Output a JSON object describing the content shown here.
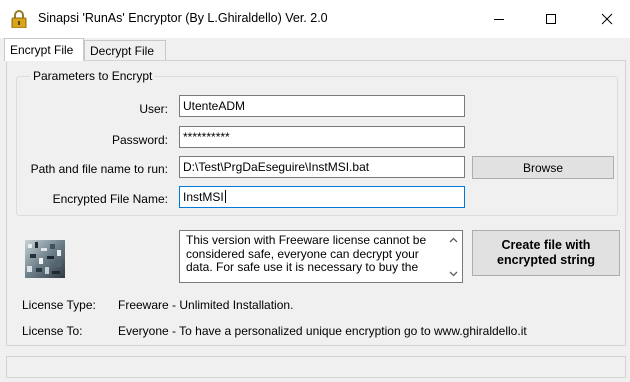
{
  "window": {
    "title": "Sinapsi 'RunAs' Encryptor (By L.Ghiraldello) Ver. 2.0",
    "icon": "lock-icon"
  },
  "tabs": [
    {
      "label": "Encrypt File",
      "active": true
    },
    {
      "label": "Decrypt File",
      "active": false
    }
  ],
  "group": {
    "legend": "Parameters to Encrypt"
  },
  "form": {
    "user_label": "User:",
    "user_value": "UtenteADM",
    "password_label": "Password:",
    "password_value": "**********",
    "path_label": "Path and file name to run:",
    "path_value": "D:\\Test\\PrgDaEseguire\\InstMSI.bat",
    "enc_label": "Encrypted File Name:",
    "enc_value": "InstMSI"
  },
  "buttons": {
    "browse": "Browse",
    "create_line1": "Create file with",
    "create_line2": "encrypted string"
  },
  "notice": {
    "line1": "This version with Freeware license cannot be",
    "line2": "considered safe, everyone can decrypt your",
    "line3": "data. For safe use it is necessary to buy the"
  },
  "license": {
    "type_label": "License Type:",
    "type_value": "Freeware - Unlimited Installation.",
    "to_label": "License To:",
    "to_value": "Everyone - To have a personalized unique encryption go to www.ghiraldello.it"
  },
  "colors": {
    "focus": "#0078d7",
    "lock_gold": "#d9a419"
  }
}
